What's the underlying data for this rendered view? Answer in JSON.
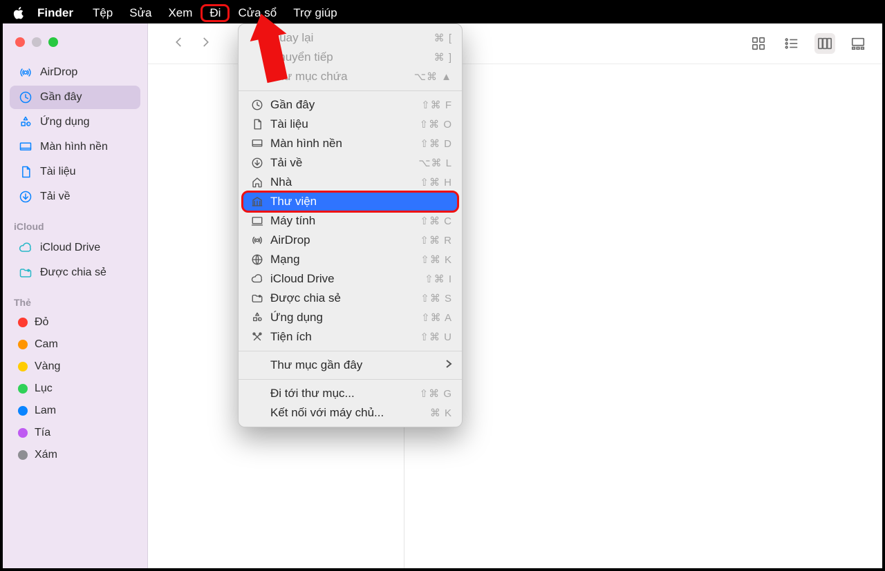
{
  "menubar": {
    "app": "Finder",
    "items": [
      "Tệp",
      "Sửa",
      "Xem",
      "Đi",
      "Cửa sổ",
      "Trợ giúp"
    ],
    "highlighted_index": 3
  },
  "sidebar": {
    "favorites": [
      {
        "label": "AirDrop",
        "icon": "airdrop",
        "color": "#0a84ff"
      },
      {
        "label": "Gần đây",
        "icon": "clock",
        "color": "#0a84ff",
        "active": true
      },
      {
        "label": "Ứng dụng",
        "icon": "apps",
        "color": "#0a84ff"
      },
      {
        "label": "Màn hình nền",
        "icon": "desktop",
        "color": "#0a84ff"
      },
      {
        "label": "Tài liệu",
        "icon": "document",
        "color": "#0a84ff"
      },
      {
        "label": "Tải về",
        "icon": "download",
        "color": "#0a84ff"
      }
    ],
    "icloud_label": "iCloud",
    "icloud": [
      {
        "label": "iCloud Drive",
        "icon": "cloud",
        "color": "#29b8c8"
      },
      {
        "label": "Được chia sẻ",
        "icon": "shared-folder",
        "color": "#29b8c8"
      }
    ],
    "tags_label": "Thẻ",
    "tags": [
      {
        "label": "Đỏ",
        "color": "#ff3b30"
      },
      {
        "label": "Cam",
        "color": "#ff9500"
      },
      {
        "label": "Vàng",
        "color": "#ffcc00"
      },
      {
        "label": "Lục",
        "color": "#30d158"
      },
      {
        "label": "Lam",
        "color": "#0a84ff"
      },
      {
        "label": "Tía",
        "color": "#bf5af2"
      },
      {
        "label": "Xám",
        "color": "#8e8e93"
      }
    ]
  },
  "dropdown": {
    "groups": [
      [
        {
          "label": "Quay lại",
          "shortcut": "⌘ [",
          "disabled": true,
          "partially_hidden": true
        },
        {
          "label": "Chuyển tiếp",
          "shortcut": "⌘ ]",
          "disabled": true
        },
        {
          "label": "Thư mục chứa",
          "shortcut": "⌥⌘ ▲",
          "disabled": true
        }
      ],
      [
        {
          "label": "Gần đây",
          "icon": "clock",
          "shortcut": "⇧⌘ F"
        },
        {
          "label": "Tài liệu",
          "icon": "document",
          "shortcut": "⇧⌘ O"
        },
        {
          "label": "Màn hình nền",
          "icon": "desktop",
          "shortcut": "⇧⌘ D"
        },
        {
          "label": "Tải về",
          "icon": "download",
          "shortcut": "⌥⌘ L"
        },
        {
          "label": "Nhà",
          "icon": "home",
          "shortcut": "⇧⌘ H"
        },
        {
          "label": "Thư viện",
          "icon": "library",
          "shortcut": "",
          "highlighted": true
        },
        {
          "label": "Máy tính",
          "icon": "computer",
          "shortcut": "⇧⌘ C"
        },
        {
          "label": "AirDrop",
          "icon": "airdrop",
          "shortcut": "⇧⌘ R"
        },
        {
          "label": "Mạng",
          "icon": "network",
          "shortcut": "⇧⌘ K"
        },
        {
          "label": "iCloud Drive",
          "icon": "cloud",
          "shortcut": "⇧⌘ I"
        },
        {
          "label": "Được chia sẻ",
          "icon": "shared-folder",
          "shortcut": "⇧⌘ S"
        },
        {
          "label": "Ứng dụng",
          "icon": "apps",
          "shortcut": "⇧⌘ A"
        },
        {
          "label": "Tiện ích",
          "icon": "utilities",
          "shortcut": "⇧⌘ U"
        }
      ],
      [
        {
          "label": "Thư mục gần đây",
          "submenu": true
        }
      ],
      [
        {
          "label": "Đi tới thư mục...",
          "shortcut": "⇧⌘ G"
        },
        {
          "label": "Kết nối với máy chủ...",
          "shortcut": "⌘ K"
        }
      ]
    ]
  }
}
